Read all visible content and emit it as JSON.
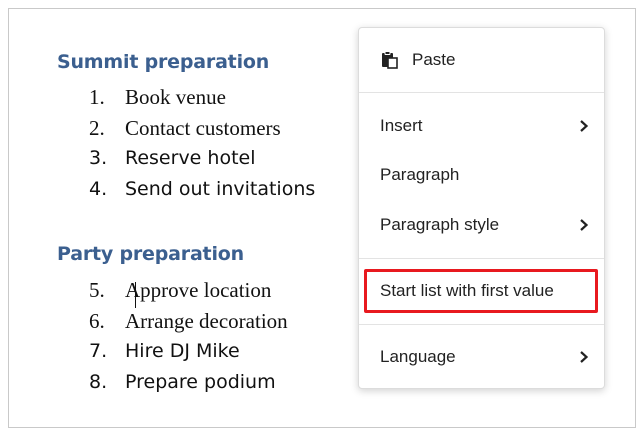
{
  "document": {
    "sections": [
      {
        "heading": "Summit preparation",
        "items": [
          {
            "num": "1.",
            "text": "Book venue",
            "font": "serif"
          },
          {
            "num": "2.",
            "text": "Contact customers",
            "font": "serif"
          },
          {
            "num": "3.",
            "text": "Reserve hotel",
            "font": "sans"
          },
          {
            "num": "4.",
            "text": "Send out invitations",
            "font": "sans"
          }
        ]
      },
      {
        "heading": "Party preparation",
        "items": [
          {
            "num": "5.",
            "text": "Approve location",
            "font": "serif"
          },
          {
            "num": "6.",
            "text": "Arrange decoration",
            "font": "serif"
          },
          {
            "num": "7.",
            "text": "Hire DJ Mike",
            "font": "sans"
          },
          {
            "num": "8.",
            "text": "Prepare podium",
            "font": "sans"
          }
        ]
      }
    ]
  },
  "context_menu": {
    "paste": "Paste",
    "insert": "Insert",
    "paragraph": "Paragraph",
    "paragraph_style": "Paragraph style",
    "start_list": "Start list with first value",
    "language": "Language"
  },
  "colors": {
    "heading": "#3b5f8f",
    "highlight": "#e8191f"
  },
  "icons": {
    "paste": "clipboard-icon",
    "submenu": "chevron-right-icon"
  }
}
